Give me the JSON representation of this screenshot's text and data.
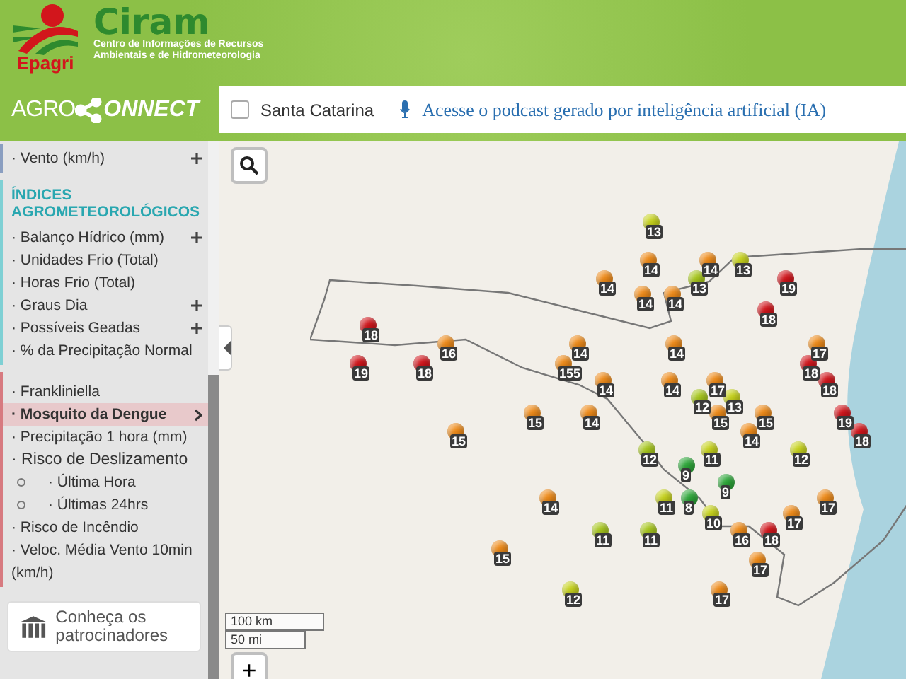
{
  "header": {
    "epagri_logo": "Epagri",
    "ciram_title": "Ciram",
    "ciram_subtitle": [
      "Centro de Informações de Recursos",
      "Ambientais e de Hidrometeorologia"
    ]
  },
  "brand": {
    "left": "AGRO",
    "right": "ONNECT"
  },
  "topbar": {
    "state_checkbox": {
      "label": "Santa Catarina",
      "checked": false
    },
    "podcast_link": "Acesse o podcast gerado por inteligência artificial (IA)"
  },
  "sidebar": {
    "top_item": {
      "label": "· Vento (km/h)",
      "expandable": true
    },
    "section": {
      "title": "ÍNDICES AGROMETEOROLÓGICOS",
      "items": [
        {
          "label": "· Balanço Hídrico (mm)",
          "expandable": true
        },
        {
          "label": "· Unidades Frio (Total)",
          "expandable": false
        },
        {
          "label": "· Horas Frio (Total)",
          "expandable": false
        },
        {
          "label": "· Graus Dia",
          "expandable": true
        },
        {
          "label": "· Possíveis Geadas",
          "expandable": true
        },
        {
          "label": "· % da Precipitação Normal",
          "expandable": false
        }
      ]
    },
    "group": [
      {
        "kind": "item",
        "label": "· Frankliniella",
        "selected": false
      },
      {
        "kind": "item",
        "label": "· Mosquito da Dengue",
        "selected": true
      },
      {
        "kind": "item",
        "label": "· Precipitação 1 hora (mm)",
        "selected": false
      },
      {
        "kind": "heading",
        "label": "· Risco de Deslizamento",
        "selected": false
      },
      {
        "kind": "sub",
        "label": "· Última Hora",
        "selected": false
      },
      {
        "kind": "sub",
        "label": "· Últimas 24hrs",
        "selected": false
      },
      {
        "kind": "item",
        "label": "· Risco de Incêndio",
        "selected": false
      },
      {
        "kind": "item",
        "label": "· Veloc. Média Vento 10min (km/h)",
        "selected": false
      }
    ],
    "sponsor_card": "Conheça os patrocinadores"
  },
  "map": {
    "scale": [
      "100 km",
      "50 mi"
    ],
    "zoom_in": "+",
    "markers": [
      {
        "value": "13",
        "color": "#c8d41e"
      },
      {
        "value": "14",
        "color": "#f08c1a"
      },
      {
        "value": "14",
        "color": "#f08c1a"
      },
      {
        "value": "13",
        "color": "#c8d41e"
      },
      {
        "value": "14",
        "color": "#f08c1a"
      },
      {
        "value": "13",
        "color": "#a8c81e"
      },
      {
        "value": "19",
        "color": "#d2161c"
      },
      {
        "value": "14",
        "color": "#f08c1a"
      },
      {
        "value": "14",
        "color": "#f08c1a"
      },
      {
        "value": "18",
        "color": "#d2161c"
      },
      {
        "value": "18",
        "color": "#d2161c"
      },
      {
        "value": "16",
        "color": "#f08c1a"
      },
      {
        "value": "14",
        "color": "#f08c1a"
      },
      {
        "value": "14",
        "color": "#f08c1a"
      },
      {
        "value": "17",
        "color": "#f08c1a"
      },
      {
        "value": "19",
        "color": "#d2161c"
      },
      {
        "value": "18",
        "color": "#d2161c"
      },
      {
        "value": "155",
        "color": "#f08c1a"
      },
      {
        "value": "18",
        "color": "#d2161c"
      },
      {
        "value": "14",
        "color": "#f08c1a"
      },
      {
        "value": "14",
        "color": "#f08c1a"
      },
      {
        "value": "17",
        "color": "#f08c1a"
      },
      {
        "value": "18",
        "color": "#d2161c"
      },
      {
        "value": "12",
        "color": "#a8c81e"
      },
      {
        "value": "13",
        "color": "#c8d41e"
      },
      {
        "value": "15",
        "color": "#f08c1a"
      },
      {
        "value": "14",
        "color": "#f08c1a"
      },
      {
        "value": "15",
        "color": "#f08c1a"
      },
      {
        "value": "15",
        "color": "#f08c1a"
      },
      {
        "value": "19",
        "color": "#d2161c"
      },
      {
        "value": "15",
        "color": "#f08c1a"
      },
      {
        "value": "14",
        "color": "#f08c1a"
      },
      {
        "value": "18",
        "color": "#d2161c"
      },
      {
        "value": "12",
        "color": "#a8c81e"
      },
      {
        "value": "11",
        "color": "#c8d41e"
      },
      {
        "value": "12",
        "color": "#c8d41e"
      },
      {
        "value": "9",
        "color": "#2ea83a"
      },
      {
        "value": "9",
        "color": "#2ea83a"
      },
      {
        "value": "14",
        "color": "#f08c1a"
      },
      {
        "value": "11",
        "color": "#c8d41e"
      },
      {
        "value": "8",
        "color": "#2ea83a"
      },
      {
        "value": "17",
        "color": "#f08c1a"
      },
      {
        "value": "10",
        "color": "#c8d41e"
      },
      {
        "value": "17",
        "color": "#f08c1a"
      },
      {
        "value": "11",
        "color": "#a8c81e"
      },
      {
        "value": "11",
        "color": "#a8c81e"
      },
      {
        "value": "16",
        "color": "#f08c1a"
      },
      {
        "value": "18",
        "color": "#d2161c"
      },
      {
        "value": "15",
        "color": "#f08c1a"
      },
      {
        "value": "17",
        "color": "#f08c1a"
      },
      {
        "value": "12",
        "color": "#c8d41e"
      },
      {
        "value": "17",
        "color": "#f08c1a"
      }
    ]
  }
}
